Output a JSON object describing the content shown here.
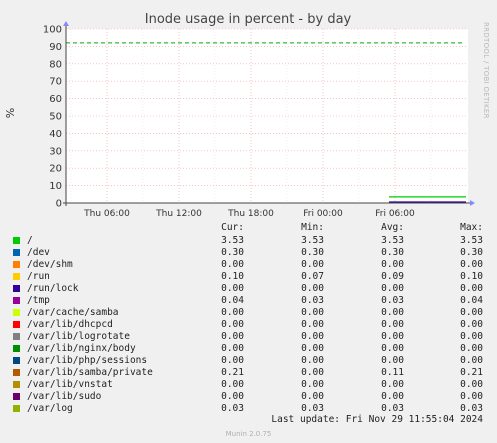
{
  "chart_data": {
    "type": "line",
    "title": "Inode usage in percent - by day",
    "ylabel": "%",
    "ylim": [
      0,
      100
    ],
    "yticks": [
      0,
      10,
      20,
      30,
      40,
      50,
      60,
      70,
      80,
      90,
      100
    ],
    "xticks": [
      "Thu 06:00",
      "Thu 12:00",
      "Thu 18:00",
      "Fri 00:00",
      "Fri 06:00"
    ],
    "warning_level": 92,
    "grid": true,
    "series": [
      {
        "name": "/",
        "color": "#00cc00",
        "values": [
          3.53
        ]
      },
      {
        "name": "/dev",
        "color": "#0066b3",
        "values": [
          0.3
        ]
      },
      {
        "name": "/run/lock",
        "color": "#330099",
        "values": [
          0.0
        ]
      }
    ]
  },
  "side_label": "RRDTOOL / TOBI OETIKER",
  "legend": {
    "headers": [
      "Cur:",
      "Min:",
      "Avg:",
      "Max:"
    ],
    "rows": [
      {
        "name": "/",
        "color": "#00cc00",
        "cur": "3.53",
        "min": "3.53",
        "avg": "3.53",
        "max": "3.53"
      },
      {
        "name": "/dev",
        "color": "#0066b3",
        "cur": "0.30",
        "min": "0.30",
        "avg": "0.30",
        "max": "0.30"
      },
      {
        "name": "/dev/shm",
        "color": "#ff8000",
        "cur": "0.00",
        "min": "0.00",
        "avg": "0.00",
        "max": "0.00"
      },
      {
        "name": "/run",
        "color": "#ffcc00",
        "cur": "0.10",
        "min": "0.07",
        "avg": "0.09",
        "max": "0.10"
      },
      {
        "name": "/run/lock",
        "color": "#330099",
        "cur": "0.00",
        "min": "0.00",
        "avg": "0.00",
        "max": "0.00"
      },
      {
        "name": "/tmp",
        "color": "#990099",
        "cur": "0.04",
        "min": "0.03",
        "avg": "0.03",
        "max": "0.04"
      },
      {
        "name": "/var/cache/samba",
        "color": "#ccff00",
        "cur": "0.00",
        "min": "0.00",
        "avg": "0.00",
        "max": "0.00"
      },
      {
        "name": "/var/lib/dhcpcd",
        "color": "#ff0000",
        "cur": "0.00",
        "min": "0.00",
        "avg": "0.00",
        "max": "0.00"
      },
      {
        "name": "/var/lib/logrotate",
        "color": "#808080",
        "cur": "0.00",
        "min": "0.00",
        "avg": "0.00",
        "max": "0.00"
      },
      {
        "name": "/var/lib/nginx/body",
        "color": "#008f00",
        "cur": "0.00",
        "min": "0.00",
        "avg": "0.00",
        "max": "0.00"
      },
      {
        "name": "/var/lib/php/sessions",
        "color": "#00487d",
        "cur": "0.00",
        "min": "0.00",
        "avg": "0.00",
        "max": "0.00"
      },
      {
        "name": "/var/lib/samba/private",
        "color": "#b35a00",
        "cur": "0.21",
        "min": "0.00",
        "avg": "0.11",
        "max": "0.21"
      },
      {
        "name": "/var/lib/vnstat",
        "color": "#b38f00",
        "cur": "0.00",
        "min": "0.00",
        "avg": "0.00",
        "max": "0.00"
      },
      {
        "name": "/var/lib/sudo",
        "color": "#6b006b",
        "cur": "0.00",
        "min": "0.00",
        "avg": "0.00",
        "max": "0.00"
      },
      {
        "name": "/var/log",
        "color": "#8fb300",
        "cur": "0.03",
        "min": "0.03",
        "avg": "0.03",
        "max": "0.03"
      }
    ]
  },
  "last_update": "Last update: Fri Nov 29 11:55:04 2024",
  "footer": "Munin 2.0.75"
}
